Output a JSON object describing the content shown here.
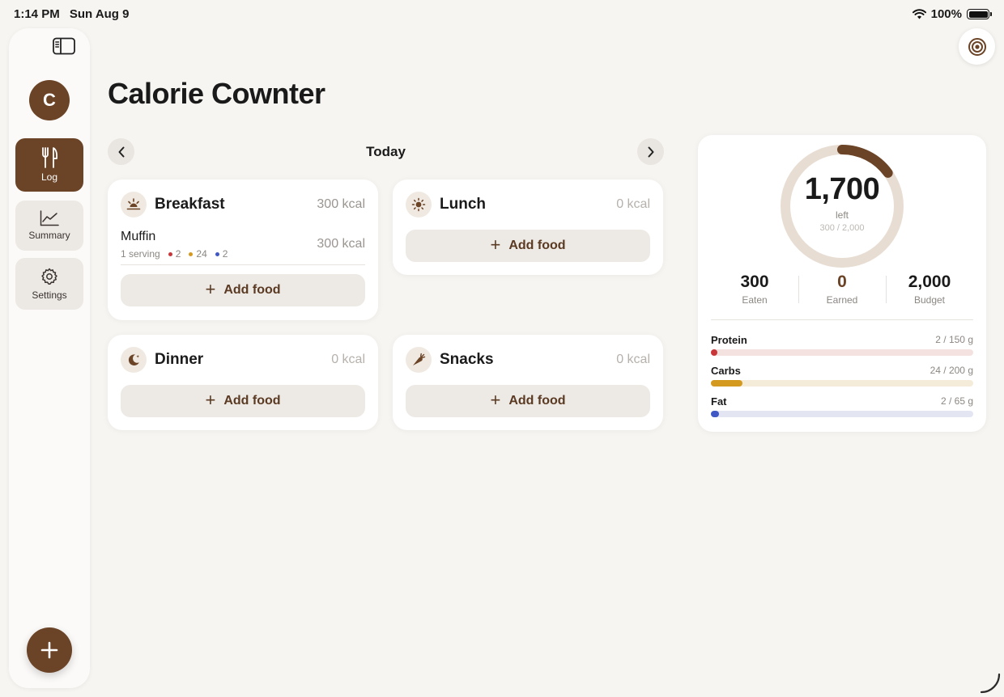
{
  "status_bar": {
    "time": "1:14 PM",
    "date": "Sun Aug 9",
    "battery": "100%"
  },
  "sidebar": {
    "avatar_initial": "C",
    "items": [
      {
        "label": "Log",
        "icon": "fork-knife-icon",
        "active": true
      },
      {
        "label": "Summary",
        "icon": "chart-line-icon",
        "active": false
      },
      {
        "label": "Settings",
        "icon": "gear-icon",
        "active": false
      }
    ]
  },
  "header": {
    "title": "Calorie Cownter"
  },
  "date_nav": {
    "label": "Today"
  },
  "meals": {
    "breakfast": {
      "name": "Breakfast",
      "kcal": "300 kcal",
      "items": [
        {
          "name": "Muffin",
          "serving": "1 serving",
          "protein": "2",
          "carbs": "24",
          "fat": "2",
          "kcal": "300 kcal"
        }
      ],
      "add_label": "Add food"
    },
    "lunch": {
      "name": "Lunch",
      "kcal": "0 kcal",
      "add_label": "Add food"
    },
    "dinner": {
      "name": "Dinner",
      "kcal": "0 kcal",
      "add_label": "Add food"
    },
    "snacks": {
      "name": "Snacks",
      "kcal": "0 kcal",
      "add_label": "Add food"
    }
  },
  "summary": {
    "remaining": "1,700",
    "remaining_label": "left",
    "progress_text": "300 / 2,000",
    "progress_fraction": 0.15,
    "stats": [
      {
        "value": "300",
        "label": "Eaten"
      },
      {
        "value": "0",
        "label": "Earned"
      },
      {
        "value": "2,000",
        "label": "Budget"
      }
    ],
    "macros": [
      {
        "name": "Protein",
        "amount": "2 / 150 g",
        "fraction": 0.013,
        "color": "#c8363a",
        "track": "#f3e2e0"
      },
      {
        "name": "Carbs",
        "amount": "24 / 200 g",
        "fraction": 0.12,
        "color": "#d49a1f",
        "track": "#f4ecd9"
      },
      {
        "name": "Fat",
        "amount": "2 / 65 g",
        "fraction": 0.031,
        "color": "#3f58c4",
        "track": "#e3e5f3"
      }
    ]
  },
  "colors": {
    "accent": "#6b4326",
    "ring_track": "#e8ddd3",
    "protein_dot": "#c8363a",
    "carbs_dot": "#d49a1f",
    "fat_dot": "#3f58c4"
  }
}
